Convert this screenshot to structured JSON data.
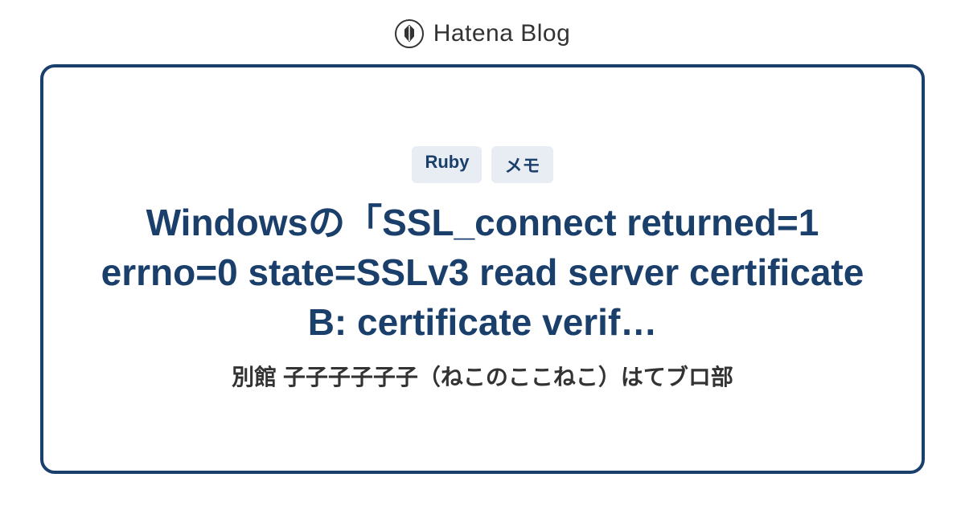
{
  "header": {
    "service_name": "Hatena Blog"
  },
  "card": {
    "tags": [
      "Ruby",
      "メモ"
    ],
    "title": "Windowsの「SSL_connect returned=1 errno=0 state=SSLv3 read server certificate B: certificate verif…",
    "blog_name": "別館 子子子子子子（ねこのここねこ）はてブロ部"
  }
}
